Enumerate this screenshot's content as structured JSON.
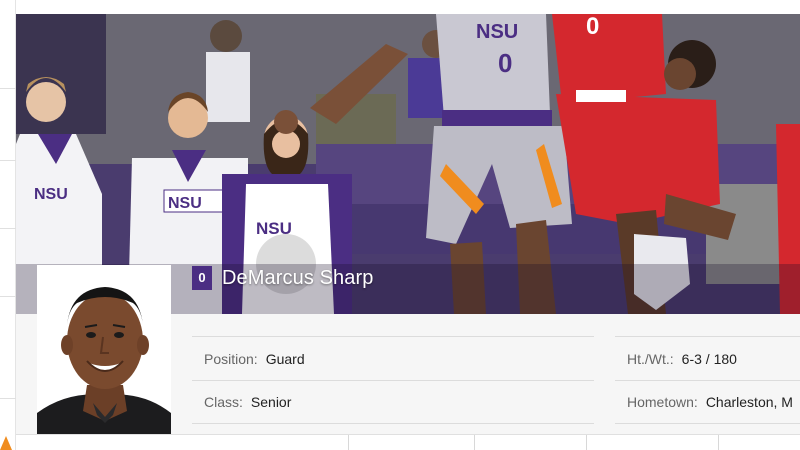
{
  "player": {
    "jersey_number": "0",
    "name": "DeMarcus Sharp",
    "position_label": "Position:",
    "position_value": "Guard",
    "class_label": "Class:",
    "class_value": "Senior",
    "htwt_label": "Ht./Wt.:",
    "htwt_value": "6-3 / 180",
    "hometown_label": "Hometown:",
    "hometown_value": "Charleston, M"
  },
  "hero": {
    "jersey_text": "NSU",
    "jersey_number": "0",
    "cheer_text_1": "NSU",
    "cheer_text_2": "NSU",
    "cheer_text_3": "NSU"
  },
  "colors": {
    "brand_purple": "#4b2e83",
    "opponent_red": "#d4282e",
    "panel_bg": "#f6f6f6"
  }
}
